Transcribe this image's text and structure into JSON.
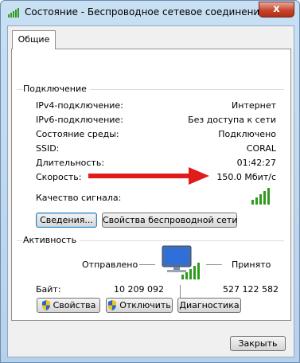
{
  "window": {
    "title": "Состояние - Беспроводное сетевое соединение",
    "close_glyph": "x"
  },
  "tabs": [
    {
      "label": "Общие"
    }
  ],
  "connection": {
    "heading": "Подключение",
    "rows": [
      {
        "label": "IPv4-подключение:",
        "value": "Интернет"
      },
      {
        "label": "IPv6-подключение:",
        "value": "Без доступа к сети"
      },
      {
        "label": "Состояние среды:",
        "value": "Подключено"
      },
      {
        "label": "SSID:",
        "value": "CORAL"
      },
      {
        "label": "Длительность:",
        "value": "01:42:27"
      },
      {
        "label": "Скорость:",
        "value": "150.0 Мбит/с"
      }
    ],
    "signal_label": "Качество сигнала:",
    "signal_bars": 5,
    "buttons": {
      "details": "Сведения...",
      "wireless_props": "Свойства беспроводной сети"
    }
  },
  "activity": {
    "heading": "Активность",
    "sent_label": "Отправлено",
    "received_label": "Принято",
    "bytes_label": "Байт:",
    "bytes_sent": "10 209 092",
    "bytes_received": "527 122 582",
    "buttons": {
      "properties": "Свойства",
      "disable": "Отключить",
      "diagnose": "Диагностика"
    }
  },
  "footer": {
    "close_button": "Закрыть"
  },
  "colors": {
    "arrow": "#e01b1b",
    "signal": "#2f9a1d"
  }
}
